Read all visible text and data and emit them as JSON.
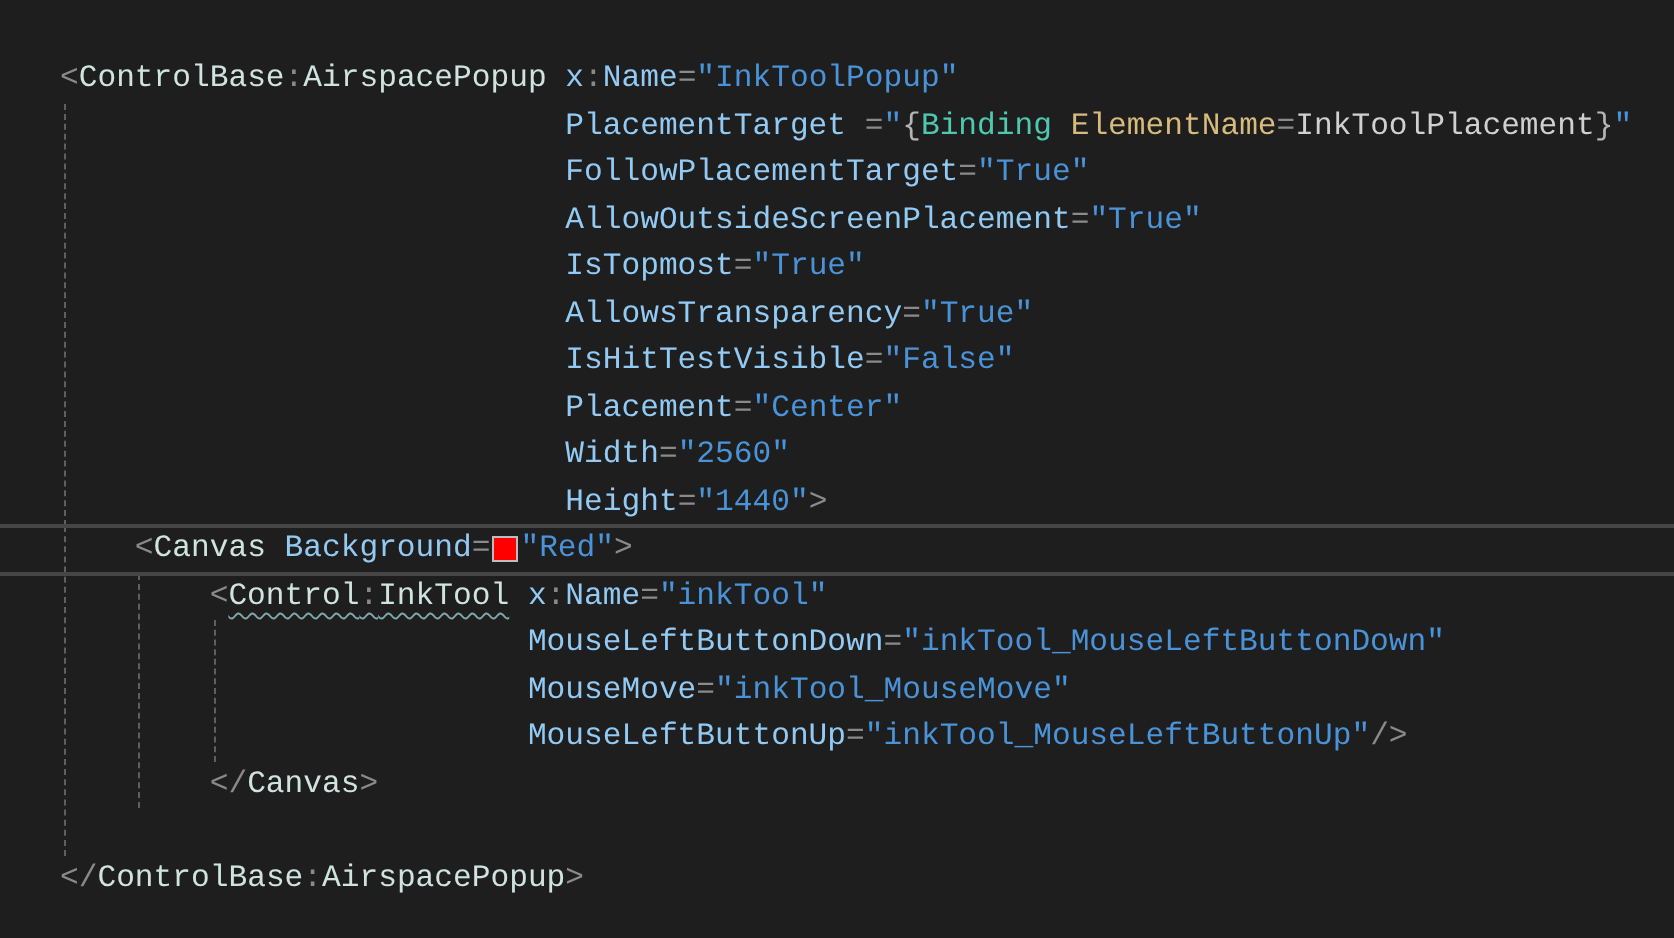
{
  "code": [
    {
      "kind": "element",
      "open_tag": [
        {
          "kind": "punct",
          "text": "<"
        },
        {
          "kind": "tag",
          "text": "ControlBase"
        },
        {
          "kind": "punct",
          "text": ":"
        },
        {
          "kind": "tag",
          "text": "AirspacePopup"
        }
      ],
      "squiggle": false,
      "current": false,
      "attributes": [
        [
          {
            "kind": "attr",
            "text": "x"
          },
          {
            "kind": "punct",
            "text": ":"
          },
          {
            "kind": "attr",
            "text": "Name"
          },
          {
            "kind": "punct",
            "text": "="
          },
          {
            "kind": "value",
            "text": "\"InkToolPopup\""
          }
        ],
        [
          {
            "kind": "attr",
            "text": "PlacementTarget "
          },
          {
            "kind": "punct",
            "text": "="
          },
          {
            "kind": "value",
            "text": "\""
          },
          {
            "kind": "brace",
            "text": "{"
          },
          {
            "kind": "markup",
            "text": "Binding "
          },
          {
            "kind": "markup_prop",
            "text": "ElementName"
          },
          {
            "kind": "punct",
            "text": "="
          },
          {
            "kind": "markup_value",
            "text": "InkToolPlacement"
          },
          {
            "kind": "brace",
            "text": "}"
          },
          {
            "kind": "value",
            "text": "\""
          }
        ],
        [
          {
            "kind": "attr",
            "text": "FollowPlacementTarget"
          },
          {
            "kind": "punct",
            "text": "="
          },
          {
            "kind": "value",
            "text": "\"True\""
          }
        ],
        [
          {
            "kind": "attr",
            "text": "AllowOutsideScreenPlacement"
          },
          {
            "kind": "punct",
            "text": "="
          },
          {
            "kind": "value",
            "text": "\"True\""
          }
        ],
        [
          {
            "kind": "attr",
            "text": "IsTopmost"
          },
          {
            "kind": "punct",
            "text": "="
          },
          {
            "kind": "value",
            "text": "\"True\""
          }
        ],
        [
          {
            "kind": "attr",
            "text": "AllowsTransparency"
          },
          {
            "kind": "punct",
            "text": "="
          },
          {
            "kind": "value",
            "text": "\"True\""
          }
        ],
        [
          {
            "kind": "attr",
            "text": "IsHitTestVisible"
          },
          {
            "kind": "punct",
            "text": "="
          },
          {
            "kind": "value",
            "text": "\"False\""
          }
        ],
        [
          {
            "kind": "attr",
            "text": "Placement"
          },
          {
            "kind": "punct",
            "text": "="
          },
          {
            "kind": "value",
            "text": "\"Center\""
          }
        ],
        [
          {
            "kind": "attr",
            "text": "Width"
          },
          {
            "kind": "punct",
            "text": "="
          },
          {
            "kind": "value",
            "text": "\"2560\""
          }
        ],
        [
          {
            "kind": "attr",
            "text": "Height"
          },
          {
            "kind": "punct",
            "text": "="
          },
          {
            "kind": "value",
            "text": "\"1440\""
          },
          {
            "kind": "punct",
            "text": ">"
          }
        ]
      ],
      "children": [
        {
          "kind": "element",
          "open_tag": [
            {
              "kind": "punct",
              "text": "<"
            },
            {
              "kind": "tag",
              "text": "Canvas"
            }
          ],
          "squiggle": false,
          "current": true,
          "attributes": [
            [
              {
                "kind": "attr",
                "text": "Background"
              },
              {
                "kind": "punct",
                "text": "="
              },
              {
                "kind": "swatch",
                "color": "#ff0000"
              },
              {
                "kind": "value",
                "text": "\"Red\""
              },
              {
                "kind": "punct",
                "text": ">"
              }
            ]
          ],
          "children": [
            {
              "kind": "element",
              "open_tag": [
                {
                  "kind": "punct",
                  "text": "<"
                },
                {
                  "kind": "tag",
                  "text": "Control"
                },
                {
                  "kind": "punct",
                  "text": ":"
                },
                {
                  "kind": "tag",
                  "text": "InkTool"
                }
              ],
              "squiggle": true,
              "current": false,
              "attributes": [
                [
                  {
                    "kind": "attr",
                    "text": "x"
                  },
                  {
                    "kind": "punct",
                    "text": ":"
                  },
                  {
                    "kind": "attr",
                    "text": "Name"
                  },
                  {
                    "kind": "punct",
                    "text": "="
                  },
                  {
                    "kind": "value",
                    "text": "\"inkTool\""
                  }
                ],
                [
                  {
                    "kind": "attr",
                    "text": "MouseLeftButtonDown"
                  },
                  {
                    "kind": "punct",
                    "text": "="
                  },
                  {
                    "kind": "value",
                    "text": "\"inkTool_MouseLeftButtonDown\""
                  }
                ],
                [
                  {
                    "kind": "attr",
                    "text": "MouseMove"
                  },
                  {
                    "kind": "punct",
                    "text": "="
                  },
                  {
                    "kind": "value",
                    "text": "\"inkTool_MouseMove\""
                  }
                ],
                [
                  {
                    "kind": "attr",
                    "text": "MouseLeftButtonUp"
                  },
                  {
                    "kind": "punct",
                    "text": "="
                  },
                  {
                    "kind": "value",
                    "text": "\"inkTool_MouseLeftButtonUp\""
                  },
                  {
                    "kind": "punct",
                    "text": "/>"
                  }
                ]
              ]
            },
            {
              "kind": "line",
              "tokens": [
                {
                  "kind": "punct",
                  "text": "</"
                },
                {
                  "kind": "tag",
                  "text": "Canvas"
                },
                {
                  "kind": "punct",
                  "text": ">"
                }
              ]
            }
          ]
        },
        {
          "kind": "blank"
        }
      ],
      "close_tag": [
        {
          "kind": "punct",
          "text": "</"
        },
        {
          "kind": "tag",
          "text": "ControlBase"
        },
        {
          "kind": "punct",
          "text": ":"
        },
        {
          "kind": "tag",
          "text": "AirspacePopup"
        },
        {
          "kind": "punct",
          "text": ">"
        }
      ]
    }
  ]
}
